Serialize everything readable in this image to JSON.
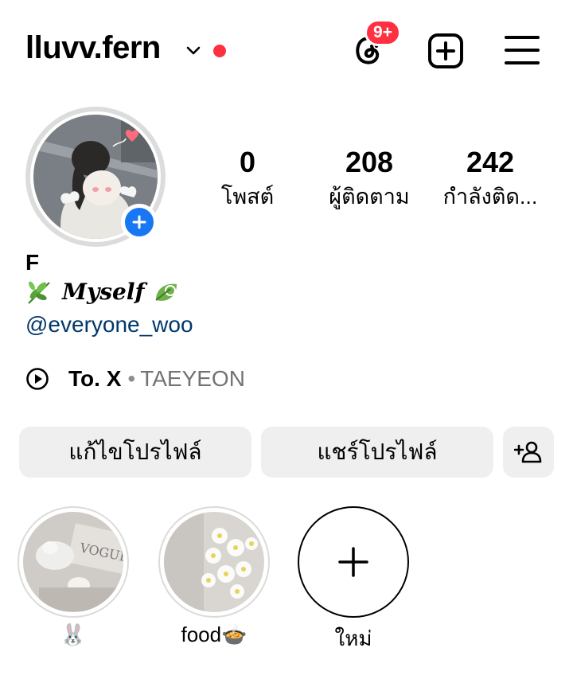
{
  "header": {
    "username": "lluvv.fern",
    "notification_badge": "9+",
    "status_dot_color": "#ff3040"
  },
  "icons": {
    "chevron": "chevron-down-icon",
    "threads": "threads-icon",
    "add": "add-post-icon",
    "menu": "hamburger-menu-icon",
    "music": "play-circle-icon",
    "add_person": "add-person-icon"
  },
  "stats": [
    {
      "value": "0",
      "label": "โพสต์"
    },
    {
      "value": "208",
      "label": "ผู้ติดตาม"
    },
    {
      "value": "242",
      "label": "กำลังติด..."
    }
  ],
  "profile": {
    "name": "F",
    "bio_text": "Myself",
    "mention": "@everyone_woo"
  },
  "music": {
    "song": "To. X",
    "separator": "•",
    "artist": "TAEYEON"
  },
  "buttons": {
    "edit_profile": "แก้ไขโปรไฟล์",
    "share_profile": "แชร์โปรไฟล์"
  },
  "highlights": [
    {
      "label": "🐰"
    },
    {
      "label": "food🍲"
    },
    {
      "label": "ใหม่"
    }
  ],
  "colors": {
    "accent_blue": "#1877f2",
    "link": "#00376b",
    "badge_red": "#ff3040",
    "button_bg": "#efefef"
  }
}
